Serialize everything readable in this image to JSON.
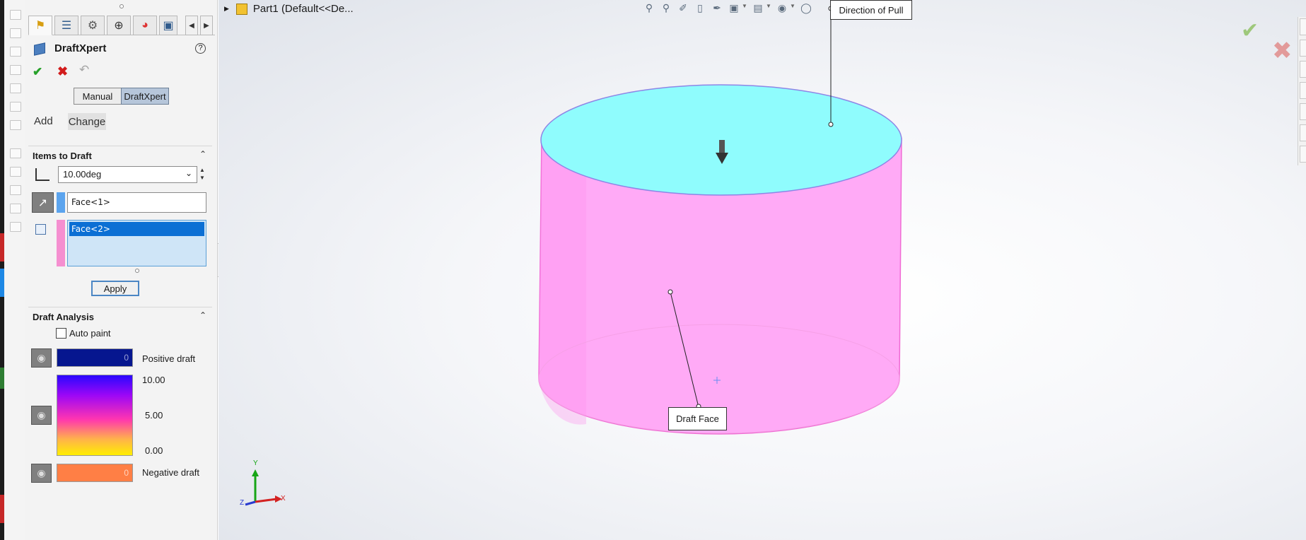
{
  "breadcrumb": {
    "text": "Part1  (Default<<De..."
  },
  "property_manager": {
    "title": "DraftXpert",
    "help": "?",
    "mode_buttons": {
      "manual": "Manual",
      "draftxpert": "DraftXpert"
    },
    "tabs": {
      "add": "Add",
      "change": "Change"
    },
    "items_to_draft": {
      "header": "Items to Draft",
      "angle": "10.00deg",
      "direction_face": "Face<1>",
      "faces": [
        "Face<2>"
      ],
      "apply": "Apply"
    },
    "draft_analysis": {
      "header": "Draft Analysis",
      "auto_paint": "Auto paint",
      "positive_label": "Positive draft",
      "positive_value": "0",
      "negative_label": "Negative draft",
      "negative_value": "0",
      "scale_max": "10.00",
      "scale_mid": "5.00",
      "scale_min": "0.00"
    }
  },
  "viewport": {
    "pull_callout": "Direction of Pull",
    "draft_callout": "Draft Face",
    "axis_x": "X",
    "axis_y": "Y",
    "axis_z": "Z"
  },
  "colors": {
    "top_face": "#8ffcfd",
    "side_face": "#ffaaf6",
    "direction_swatch": "#5ba4ee",
    "faces_swatch": "#f58fd0"
  },
  "icons": [
    "feature-manager-icon",
    "property-manager-icon",
    "configuration-manager-icon",
    "dimxpert-icon",
    "display-manager-icon",
    "ok-icon",
    "cancel-icon",
    "undo-icon",
    "help-icon",
    "eye-icon",
    "pull-arrow-icon"
  ]
}
